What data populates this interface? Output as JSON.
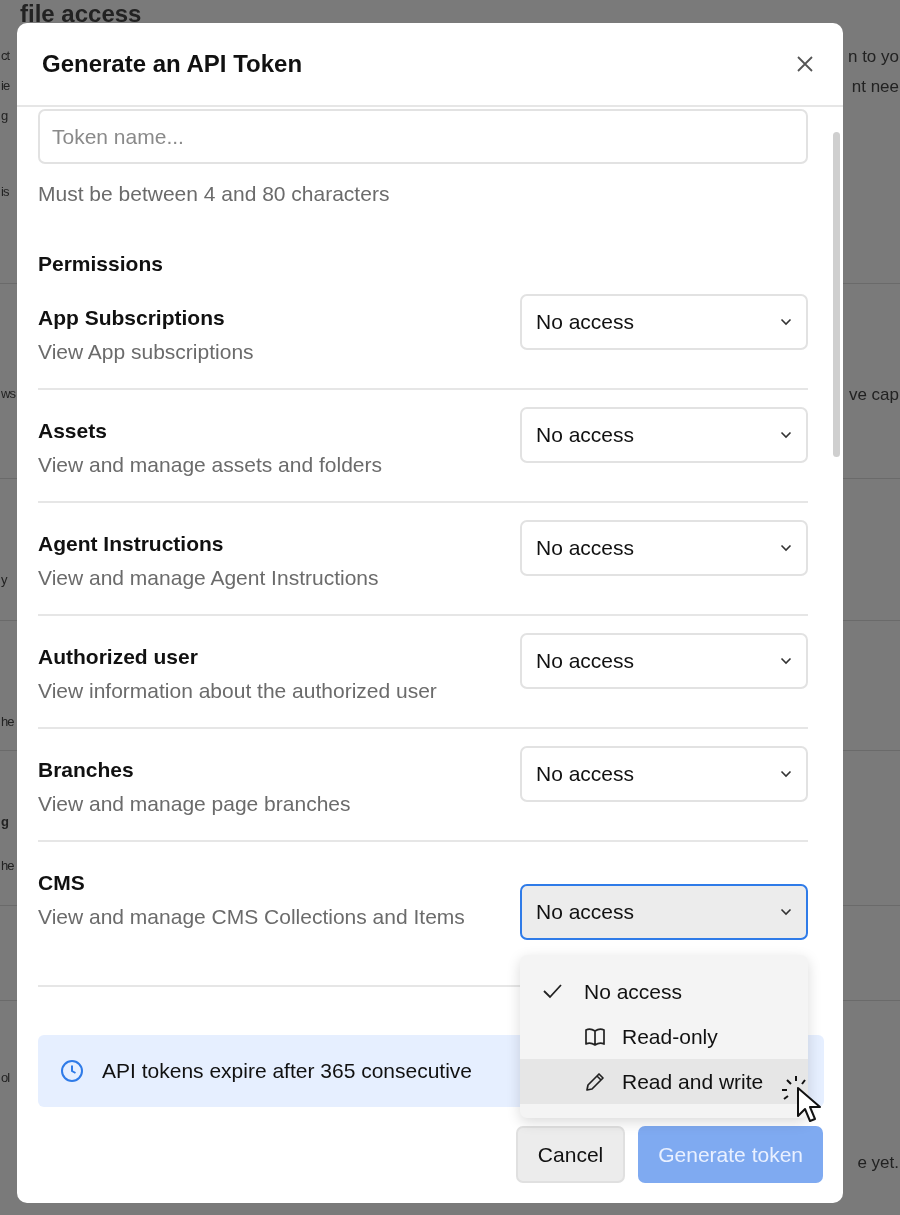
{
  "background": {
    "heading": "file access",
    "left_fragments": [
      "ct",
      "ie",
      "g",
      "is",
      "ws",
      "y",
      "he",
      "g",
      "he",
      "ol"
    ],
    "right_fragments": [
      "n to yo",
      "nt nee",
      "ve cap",
      "e yet."
    ]
  },
  "modal": {
    "title": "Generate an API Token",
    "token_field": {
      "placeholder": "Token name..."
    },
    "hint": "Must be between 4 and 80 characters",
    "permissions_heading": "Permissions",
    "permissions": [
      {
        "title": "App Subscriptions",
        "description": "View App subscriptions",
        "value": "No access",
        "open": false
      },
      {
        "title": "Assets",
        "description": "View and manage assets and folders",
        "value": "No access",
        "open": false
      },
      {
        "title": "Agent Instructions",
        "description": "View and manage Agent Instructions",
        "value": "No access",
        "open": false
      },
      {
        "title": "Authorized user",
        "description": "View information about the authorized user",
        "value": "No access",
        "open": false
      },
      {
        "title": "Branches",
        "description": "View and manage page branches",
        "value": "No access",
        "open": false
      },
      {
        "title": "CMS",
        "description": "View and manage CMS Collections and Items",
        "value": "No access",
        "open": true
      }
    ],
    "notice": "API tokens expire after 365 consecutive",
    "dropdown_options": [
      {
        "label": "No access",
        "kind": "none",
        "selected": true,
        "highlighted": false
      },
      {
        "label": "Read-only",
        "kind": "book",
        "selected": false,
        "highlighted": false
      },
      {
        "label": "Read and write",
        "kind": "pencil",
        "selected": false,
        "highlighted": true
      }
    ],
    "buttons": [
      {
        "label": "Cancel",
        "kind": "secondary",
        "disabled": false
      },
      {
        "label": "Generate token",
        "kind": "primary",
        "disabled": true
      }
    ]
  }
}
